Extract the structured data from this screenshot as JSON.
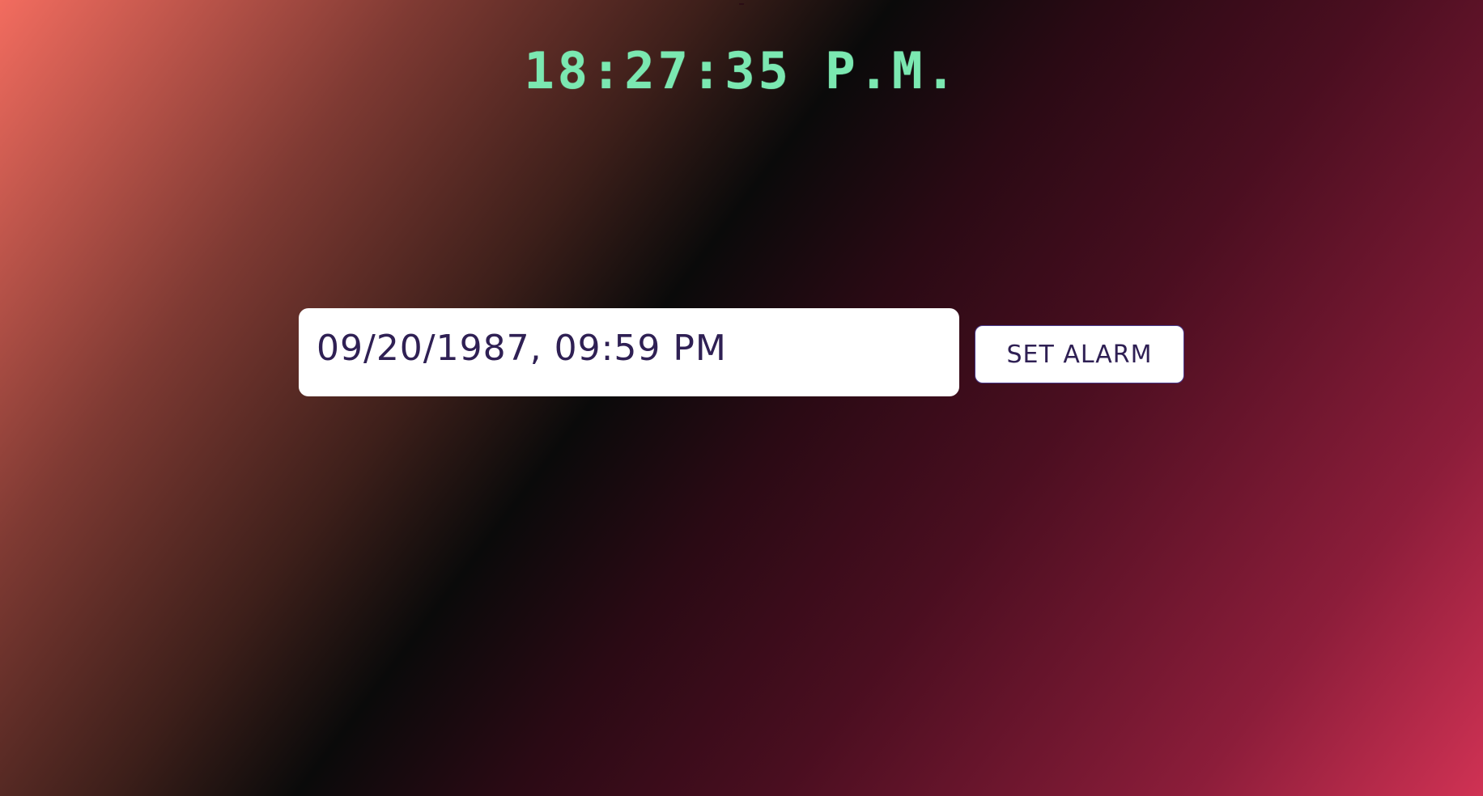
{
  "clock": {
    "time": "18:27:35 P.M."
  },
  "alarm": {
    "input_value": "09/20/1987, 09:59 PM",
    "button_label": "SET ALARM"
  },
  "colors": {
    "clock_text": "#7be8b1",
    "input_text": "#2f2054",
    "background_top_left": "#f26c5f",
    "background_middle": "#0a0a0a",
    "background_bottom_right": "#d03254"
  }
}
